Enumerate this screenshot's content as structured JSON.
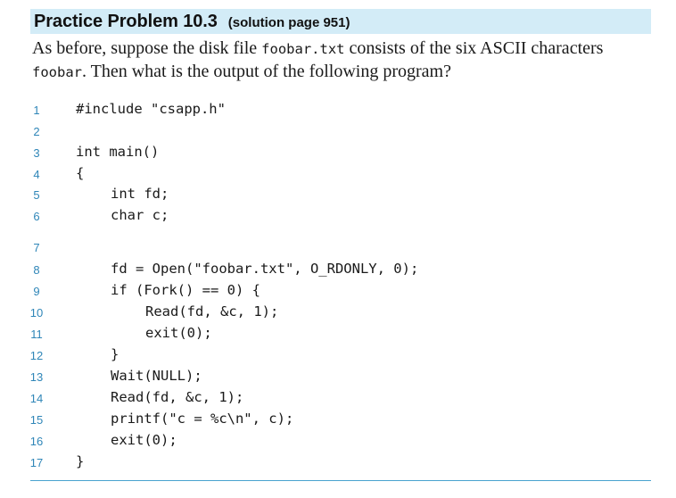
{
  "header": {
    "title": "Practice Problem 10.3",
    "subtitle": "(solution page 951)"
  },
  "intro": {
    "part1": "As before, suppose the disk file ",
    "file1": "foobar.txt",
    "part2": " consists of the six ASCII characters ",
    "file2": "foobar",
    "part3": ". Then what is the output of the following program?"
  },
  "code": [
    {
      "num": "1",
      "text": "#include \"csapp.h\""
    },
    {
      "num": "2",
      "text": ""
    },
    {
      "num": "3",
      "text": "int main()"
    },
    {
      "num": "4",
      "text": "{"
    },
    {
      "num": "5",
      "text": "int fd;"
    },
    {
      "num": "6",
      "text": "char c;"
    },
    {
      "num": "7",
      "text": ""
    },
    {
      "num": "8",
      "text": "fd = Open(\"foobar.txt\", O_RDONLY, 0);"
    },
    {
      "num": "9",
      "text": "if (Fork() == 0) {"
    },
    {
      "num": "10",
      "text": "Read(fd, &c, 1);"
    },
    {
      "num": "11",
      "text": "exit(0);"
    },
    {
      "num": "12",
      "text": "}"
    },
    {
      "num": "13",
      "text": "Wait(NULL);"
    },
    {
      "num": "14",
      "text": "Read(fd, &c, 1);"
    },
    {
      "num": "15",
      "text": "printf(\"c = %c\\n\", c);"
    },
    {
      "num": "16",
      "text": "exit(0);"
    },
    {
      "num": "17",
      "text": "}"
    }
  ]
}
